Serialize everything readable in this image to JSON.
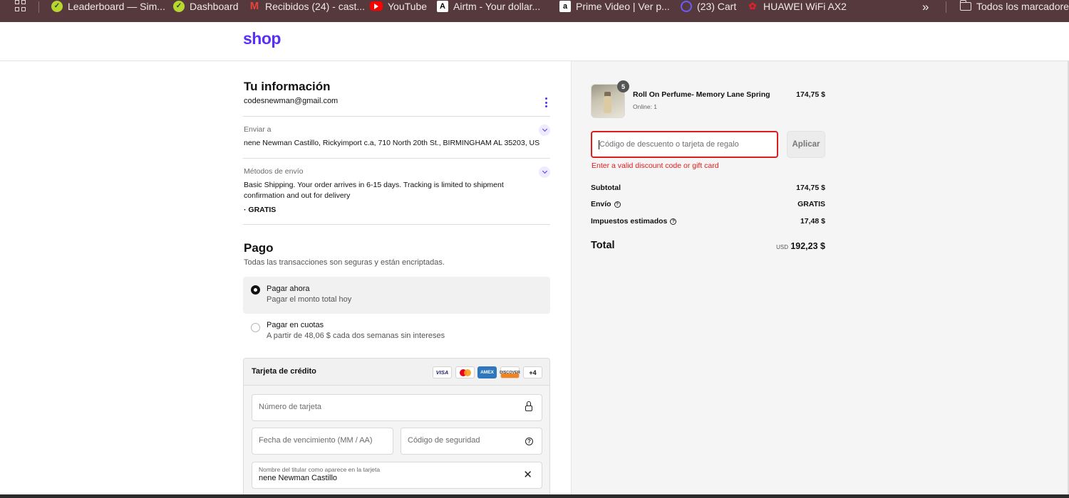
{
  "bookmarks": [
    {
      "label": "Leaderboard — Sim...",
      "icon": "simpleswap-icon"
    },
    {
      "label": "Dashboard",
      "icon": "simpleswap-icon"
    },
    {
      "label": "Recibidos (24) - cast...",
      "icon": "gmail-icon"
    },
    {
      "label": "YouTube",
      "icon": "youtube-icon"
    },
    {
      "label": "Airtm - Your dollar...",
      "icon": "airtm-icon"
    },
    {
      "label": "Prime Video | Ver p...",
      "icon": "amazon-icon"
    },
    {
      "label": "(23) Cart",
      "icon": "cart-icon"
    },
    {
      "label": "HUAWEI WiFi AX2",
      "icon": "huawei-icon"
    }
  ],
  "bookmarks_more": "»",
  "bookmarks_folder": "Todos los marcadores",
  "header": {
    "logo": "shop",
    "logo_color": "#5a31f4"
  },
  "info": {
    "title": "Tu información",
    "email": "codesnewman@gmail.com",
    "ship_to_label": "Enviar a",
    "ship_to_value": "nene Newman Castillo, Rickyimport c.a, 710 North 20th St., BIRMINGHAM AL 35203, US",
    "methods_label": "Métodos de envío",
    "methods_value": "Basic Shipping. Your order arrives in 6-15 days. Tracking is limited to shipment confirmation and out for delivery",
    "methods_price": "· GRATIS"
  },
  "payment": {
    "title": "Pago",
    "subtitle": "Todas las transacciones son seguras y están encriptadas.",
    "options": [
      {
        "title": "Pagar ahora",
        "sub": "Pagar el monto total hoy",
        "selected": true
      },
      {
        "title": "Pagar en cuotas",
        "sub": "A partir de 48,06 $ cada dos semanas sin intereses",
        "selected": false
      }
    ],
    "card": {
      "title": "Tarjeta de crédito",
      "brands": [
        "VISA",
        "mastercard",
        "AMEX",
        "DISCOVER",
        "+4"
      ],
      "number_placeholder": "Número de tarjeta",
      "expiry_placeholder": "Fecha de vencimiento (MM / AA)",
      "cvc_placeholder": "Código de seguridad",
      "name_label": "Nombre del titular como aparece en la tarjeta",
      "name_value": "nene Newman Castillo"
    }
  },
  "summary": {
    "product_name": "Roll On Perfume- Memory Lane Spring",
    "product_sub": "Online: 1",
    "product_qty": "5",
    "product_price": "174,75 $",
    "discount_placeholder": "Código de descuento o tarjeta de regalo",
    "apply_label": "Aplicar",
    "error": "Enter a valid discount code or gift card",
    "error_color": "#dd1d1d",
    "subtotal_label": "Subtotal",
    "subtotal_value": "174,75 $",
    "shipping_label": "Envío",
    "shipping_value": "GRATIS",
    "taxes_label": "Impuestos estimados",
    "taxes_value": "17,48 $",
    "total_label": "Total",
    "total_currency": "USD",
    "total_value": "192,23 $"
  }
}
